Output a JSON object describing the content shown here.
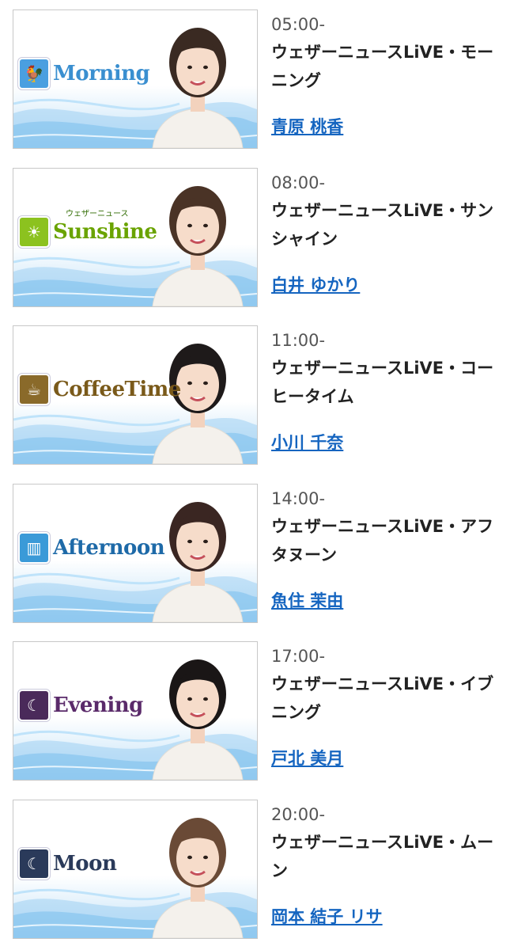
{
  "programs": [
    {
      "time": "05:00-",
      "title": "ウェザーニュースLiVE・モーニング",
      "caster": "青原 桃香",
      "logo_text": "Morning",
      "logo_sub": "",
      "icon": "rooster-icon",
      "logo_color": "#3a8fd0",
      "icon_bg": "#4a9fe0",
      "hair_color": "#3a2a22"
    },
    {
      "time": "08:00-",
      "title": "ウェザーニュースLiVE・サンシャイン",
      "caster": "白井 ゆかり",
      "logo_text": "Sunshine",
      "logo_sub": "ウェザーニュース",
      "icon": "sun-tree-icon",
      "logo_color": "#6aa300",
      "icon_bg": "#8cc21f",
      "hair_color": "#4a3326"
    },
    {
      "time": "11:00-",
      "title": "ウェザーニュースLiVE・コーヒータイム",
      "caster": "小川 千奈",
      "logo_text": "CoffeeTime",
      "logo_sub": "",
      "icon": "coffee-cup-icon",
      "logo_color": "#7a5a1a",
      "icon_bg": "#8a6a2a",
      "hair_color": "#1e1a1a"
    },
    {
      "time": "14:00-",
      "title": "ウェザーニュースLiVE・アフタヌーン",
      "caster": "魚住 茉由",
      "logo_text": "Afternoon",
      "logo_sub": "",
      "icon": "building-icon",
      "logo_color": "#1e6aa8",
      "icon_bg": "#3a9ad8",
      "hair_color": "#3a2622"
    },
    {
      "time": "17:00-",
      "title": "ウェザーニュースLiVE・イブニング",
      "caster": "戸北 美月",
      "logo_text": "Evening",
      "logo_sub": "",
      "icon": "city-night-icon",
      "logo_color": "#5a2a6a",
      "icon_bg": "#4a2a5a",
      "hair_color": "#1a1616"
    },
    {
      "time": "20:00-",
      "title": "ウェザーニュースLiVE・ムーン",
      "caster": "岡本 結子 リサ",
      "logo_text": "Moon",
      "logo_sub": "",
      "icon": "crescent-moon-icon",
      "logo_color": "#2a3a5a",
      "icon_bg": "#2a3a5a",
      "hair_color": "#6a4a36"
    }
  ]
}
